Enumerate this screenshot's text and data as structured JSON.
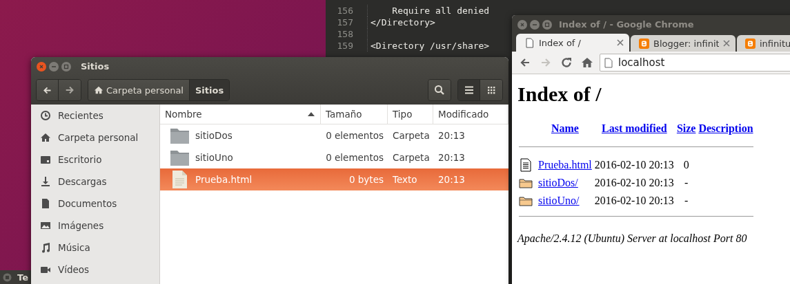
{
  "taskbar": {
    "label": "Te"
  },
  "editor": {
    "lines": [
      {
        "number": "156",
        "text": "    Require all denied"
      },
      {
        "number": "157",
        "text": "</Directory>"
      },
      {
        "number": "158"
      },
      {
        "number": "159",
        "text": "<Directory /usr/share>"
      }
    ]
  },
  "file_manager": {
    "title": "Sitios",
    "breadcrumb": [
      {
        "label": "Carpeta personal",
        "kind": "home",
        "selected": false
      },
      {
        "label": "Sitios",
        "kind": "plain",
        "selected": true
      }
    ],
    "view_buttons": [
      {
        "kind": "list",
        "selected": true
      },
      {
        "kind": "grid",
        "selected": false
      }
    ],
    "sidebar": {
      "items": [
        {
          "label": "Recientes",
          "kind": "recent"
        },
        {
          "label": "Carpeta personal",
          "kind": "home"
        },
        {
          "label": "Escritorio",
          "kind": "desktop"
        },
        {
          "label": "Descargas",
          "kind": "downloads"
        },
        {
          "label": "Documentos",
          "kind": "documents"
        },
        {
          "label": "Imágenes",
          "kind": "pictures"
        },
        {
          "label": "Música",
          "kind": "music"
        },
        {
          "label": "Vídeos",
          "kind": "videos"
        }
      ]
    },
    "columns": [
      {
        "label": "Nombre",
        "sorted": true
      },
      {
        "label": "Tamaño",
        "sorted": false
      },
      {
        "label": "Tipo",
        "sorted": false
      },
      {
        "label": "Modificado",
        "sorted": false
      }
    ],
    "rows": [
      {
        "name": "sitioDos",
        "size": "0 elementos",
        "type": "Carpeta",
        "modified": "20:13",
        "kind": "folder",
        "selected": false
      },
      {
        "name": "sitioUno",
        "size": "0 elementos",
        "type": "Carpeta",
        "modified": "20:13",
        "kind": "folder",
        "selected": false
      },
      {
        "name": "Prueba.html",
        "size": "0 bytes",
        "type": "Texto",
        "modified": "20:13",
        "kind": "file",
        "selected": true
      }
    ]
  },
  "browser": {
    "title": "Index of / - Google Chrome",
    "tabs": [
      {
        "label": "Index of /",
        "kind": "page",
        "selected": true
      },
      {
        "label": "Blogger: infinit",
        "kind": "blogger",
        "selected": false
      },
      {
        "label": "infinitu",
        "kind": "blogger",
        "selected": false
      }
    ],
    "nav": [
      {
        "kind": "back",
        "disabled": false
      },
      {
        "kind": "forward",
        "disabled": true
      },
      {
        "kind": "reload",
        "disabled": false
      },
      {
        "kind": "home",
        "disabled": false
      }
    ],
    "address": "localhost",
    "page": {
      "heading": "Index of /",
      "columns": [
        "Name",
        "Last modified",
        "Size",
        "Description"
      ],
      "rows": [
        {
          "kind": "file",
          "name": "Prueba.html",
          "modified": "2016-02-10 20:13",
          "size": "0"
        },
        {
          "kind": "folder",
          "name": "sitioDos/",
          "modified": "2016-02-10 20:13",
          "size": "-"
        },
        {
          "kind": "folder",
          "name": "sitioUno/",
          "modified": "2016-02-10 20:13",
          "size": "-"
        }
      ],
      "footer": "Apache/2.4.12 (Ubuntu) Server at localhost Port 80"
    }
  }
}
